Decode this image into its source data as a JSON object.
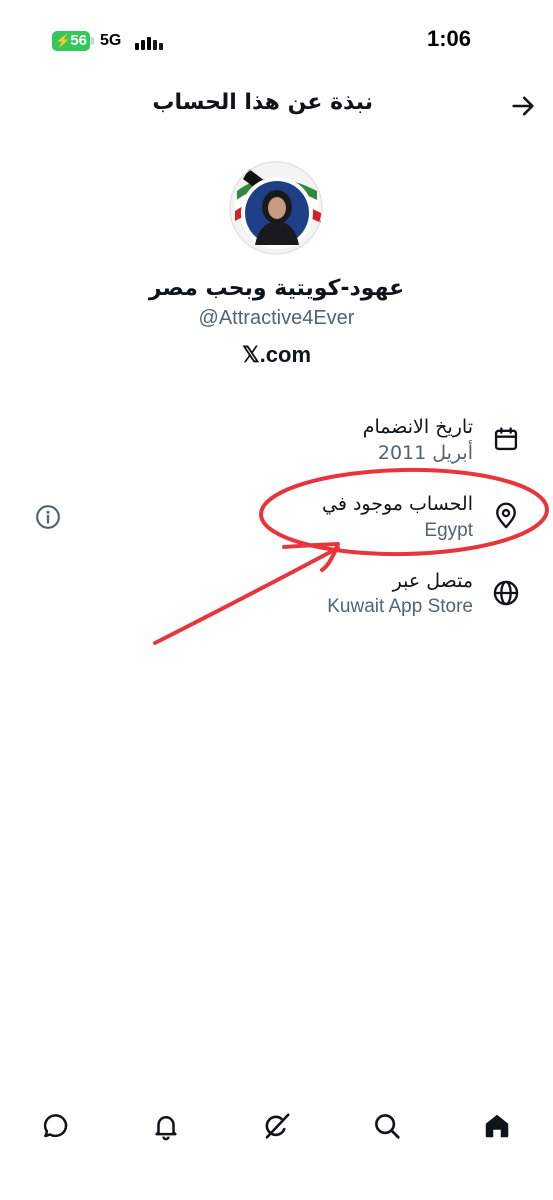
{
  "status_bar": {
    "time": "1:06",
    "battery": "56",
    "network": "5G"
  },
  "header": {
    "title": "نبذة عن هذا الحساب"
  },
  "profile": {
    "display_name": "عهود-كويتية وبحب مصر",
    "username": "@Attractive4Ever",
    "platform": "𝕏.com"
  },
  "info": {
    "joined_label": "تاريخ الانضمام",
    "joined_value": "أبريل 2011",
    "location_label": "الحساب موجود في",
    "location_value": "Egypt",
    "connected_label": "متصل عبر",
    "connected_value": "Kuwait App Store"
  },
  "annotation": {
    "color": "#e8343b"
  },
  "nav": {
    "items": [
      "chat-icon",
      "bell-icon",
      "grok-icon",
      "search-icon",
      "home-icon"
    ]
  }
}
